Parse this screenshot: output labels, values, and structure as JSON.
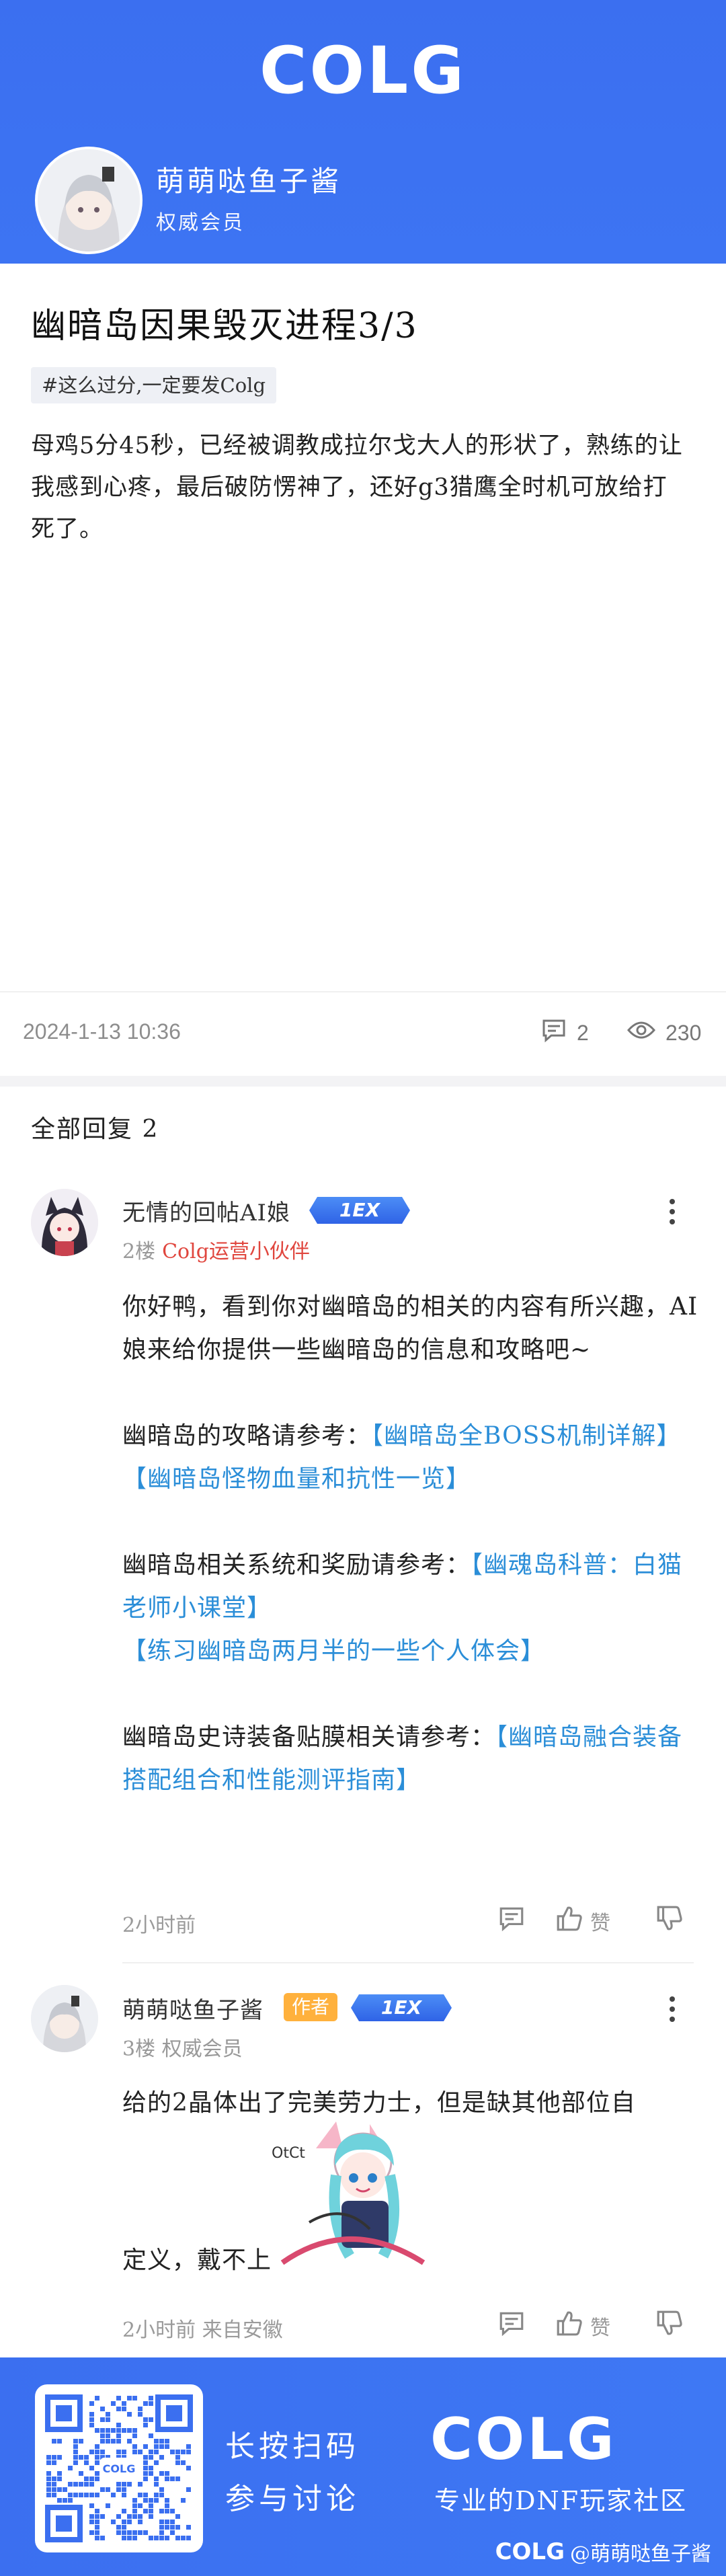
{
  "header": {
    "brand": "COLG",
    "user_name": "萌萌哒鱼子酱",
    "user_role": "权威会员"
  },
  "post": {
    "title": "幽暗岛因果毁灭进程3/3",
    "tag": "#这么过分,一定要发Colg",
    "body": "母鸡5分45秒，已经被调教成拉尔戈大人的形状了，熟练的让我感到心疼，最后破防愣神了，还好g3猎鹰全时机可放给打死了。",
    "date": "2024-1-13 10:36",
    "comment_count": "2",
    "view_count": "230"
  },
  "replies_header": "全部回复 2",
  "replies": [
    {
      "name": "无情的回帖AI娘",
      "level_badge": "1EX",
      "floor": "2楼",
      "floor_tag": "Colg运营小伙伴",
      "lines": {
        "p1": "你好鸭，看到你对幽暗岛的相关的内容有所兴趣，AI娘来给你提供一些幽暗岛的信息和攻略吧~",
        "p2_prefix": "幽暗岛的攻略请参考：",
        "link1": "【幽暗岛全BOSS机制详解】",
        "link2": "【幽暗岛怪物血量和抗性一览】",
        "p3_prefix": "幽暗岛相关系统和奖励请参考：",
        "link3": "【幽魂岛科普：白猫老师小课堂】",
        "link4": "【练习幽暗岛两月半的一些个人体会】",
        "p4_prefix": "幽暗岛史诗装备贴膜相关请参考：",
        "link5": "【幽暗岛融合装备搭配组合和性能测评指南】"
      },
      "time": "2小时前",
      "like_label": "赞"
    },
    {
      "name": "萌萌哒鱼子酱",
      "author_badge": "作者",
      "level_badge": "1EX",
      "floor": "3楼 权威会员",
      "line1": "给的2晶体出了完美劳力士，但是缺其他部位自",
      "line2": "定义，戴不上",
      "time": "2小时前 来自安徽",
      "like_label": "赞"
    }
  ],
  "footer": {
    "cta_line1": "长按扫码",
    "cta_line2": "参与讨论",
    "brand": "COLG",
    "slogan": "专业的DNF玩家社区",
    "watermark_brand": "COLG",
    "watermark_user": "@萌萌哒鱼子酱",
    "qr_label": "COLG"
  },
  "colors": {
    "brand_blue": "#3b6ff0",
    "link_blue": "#2b8ed8",
    "author_badge": "#ffb13d",
    "staff_red": "#e0463e"
  }
}
